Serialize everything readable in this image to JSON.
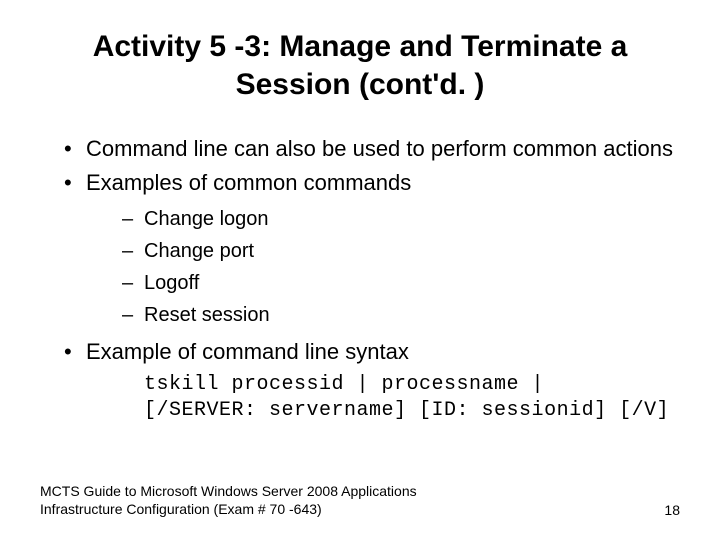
{
  "title": "Activity 5 -3: Manage and Terminate a Session (cont'd. )",
  "bullets": {
    "b1": "Command line can also be used to perform common actions",
    "b2": "Examples of common commands",
    "b3": "Example of command line syntax"
  },
  "sub": {
    "s1": "Change logon",
    "s2": "Change port",
    "s3": "Logoff",
    "s4": "Reset session"
  },
  "code": {
    "line1": "tskill processid | processname |",
    "line2": "[/SERVER: servername] [ID: sessionid] [/V]"
  },
  "footer": {
    "left": "MCTS Guide to Microsoft Windows Server 2008 Applications Infrastructure Configuration (Exam # 70 -643)",
    "page": "18"
  }
}
